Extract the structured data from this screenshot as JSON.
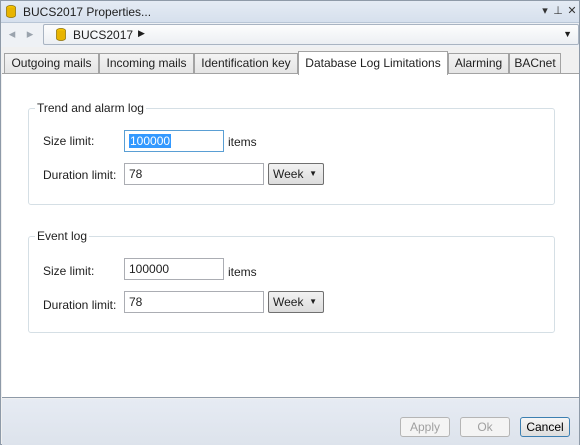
{
  "window": {
    "title": "BUCS2017 Properties...",
    "controls": {
      "menu": "▾",
      "pin": "⊥",
      "close": "✕"
    }
  },
  "nav": {
    "back_icon": "◂",
    "forward_icon": "▸",
    "breadcrumb": "BUCS2017",
    "breadcrumb_arrow": "▶",
    "dropdown_icon": "▼"
  },
  "tabs": [
    {
      "label": "Outgoing mails"
    },
    {
      "label": "Incoming mails"
    },
    {
      "label": "Identification key"
    },
    {
      "label": "Database Log Limitations",
      "active": true
    },
    {
      "label": "Alarming"
    },
    {
      "label": "BACnet"
    }
  ],
  "trend_group": {
    "legend": "Trend and alarm log",
    "size_label": "Size limit:",
    "size_value": "100000",
    "size_unit": "items",
    "duration_label": "Duration limit:",
    "duration_value": "78",
    "duration_unit": "Week"
  },
  "event_group": {
    "legend": "Event log",
    "size_label": "Size limit:",
    "size_value": "100000",
    "size_unit": "items",
    "duration_label": "Duration limit:",
    "duration_value": "78",
    "duration_unit": "Week"
  },
  "footer": {
    "apply": "Apply",
    "ok": "Ok",
    "cancel": "Cancel"
  },
  "icons": {
    "db_icon": "database-icon",
    "dropdown_arrow": "▼"
  },
  "colors": {
    "selection": "#3399ff",
    "db_icon": "#e8b400"
  }
}
